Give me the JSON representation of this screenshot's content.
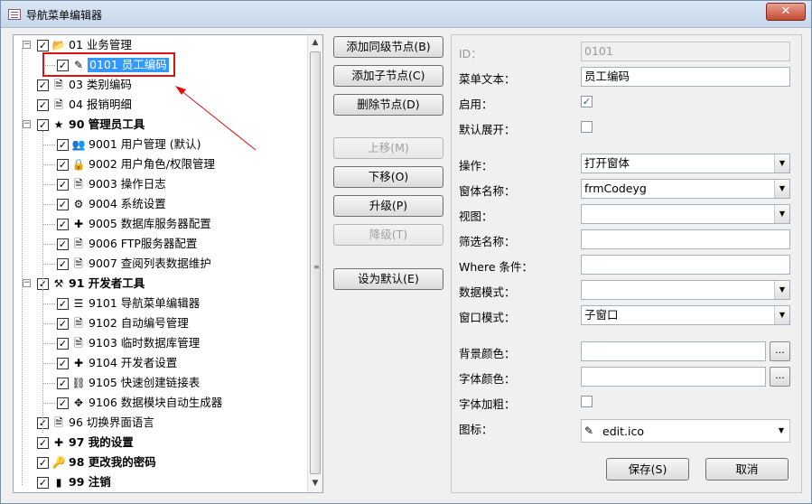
{
  "window": {
    "title": "导航菜单编辑器",
    "close_symbol": "✕"
  },
  "tree": {
    "nodes": [
      {
        "label": "01 业务管理",
        "icon": "folder-open-icon",
        "glyph": "📂",
        "bold": false,
        "checked": true,
        "level": 0,
        "expander": "−"
      },
      {
        "label": "0101 员工编码",
        "icon": "edit-icon",
        "glyph": "✎",
        "bold": false,
        "checked": true,
        "level": 1,
        "selected": true
      },
      {
        "label": "03 类别编码",
        "icon": "document-icon",
        "glyph": "🗎",
        "bold": false,
        "checked": true,
        "level": 0
      },
      {
        "label": "04 报销明细",
        "icon": "document-icon",
        "glyph": "🗎",
        "bold": false,
        "checked": true,
        "level": 0
      },
      {
        "label": "90 管理员工具",
        "icon": "star-icon",
        "glyph": "★",
        "bold": true,
        "checked": true,
        "level": 0,
        "expander": "−"
      },
      {
        "label": "9001 用户管理 (默认)",
        "icon": "users-icon",
        "glyph": "👥",
        "bold": false,
        "checked": true,
        "level": 1
      },
      {
        "label": "9002 用户角色/权限管理",
        "icon": "lock-icon",
        "glyph": "🔒",
        "bold": false,
        "checked": true,
        "level": 1
      },
      {
        "label": "9003 操作日志",
        "icon": "document-icon",
        "glyph": "🗎",
        "bold": false,
        "checked": true,
        "level": 1
      },
      {
        "label": "9004 系统设置",
        "icon": "settings-doc-icon",
        "glyph": "⚙",
        "bold": false,
        "checked": true,
        "level": 1
      },
      {
        "label": "9005 数据库服务器配置",
        "icon": "puzzle-icon",
        "glyph": "✚",
        "bold": false,
        "checked": true,
        "level": 1
      },
      {
        "label": "9006 FTP服务器配置",
        "icon": "document-icon",
        "glyph": "🗎",
        "bold": false,
        "checked": true,
        "level": 1
      },
      {
        "label": "9007 查阅列表数据维护",
        "icon": "document-icon",
        "glyph": "🗎",
        "bold": false,
        "checked": true,
        "level": 1
      },
      {
        "label": "91 开发者工具",
        "icon": "tools-icon",
        "glyph": "⚒",
        "bold": true,
        "checked": true,
        "level": 0,
        "expander": "−"
      },
      {
        "label": "9101 导航菜单编辑器",
        "icon": "menu-list-icon",
        "glyph": "☰",
        "bold": false,
        "checked": true,
        "level": 1
      },
      {
        "label": "9102 自动编号管理",
        "icon": "document-icon",
        "glyph": "🗎",
        "bold": false,
        "checked": true,
        "level": 1
      },
      {
        "label": "9103 临时数据库管理",
        "icon": "document-icon",
        "glyph": "🗎",
        "bold": false,
        "checked": true,
        "level": 1
      },
      {
        "label": "9104 开发者设置",
        "icon": "puzzle-icon",
        "glyph": "✚",
        "bold": false,
        "checked": true,
        "level": 1
      },
      {
        "label": "9105 快速创建链接表",
        "icon": "link-icon",
        "glyph": "⛓",
        "bold": false,
        "checked": true,
        "level": 1
      },
      {
        "label": "9106 数据模块自动生成器",
        "icon": "generator-icon",
        "glyph": "✥",
        "bold": false,
        "checked": true,
        "level": 1
      },
      {
        "label": "96 切换界面语言",
        "icon": "document-icon",
        "glyph": "🗎",
        "bold": false,
        "checked": true,
        "level": 0
      },
      {
        "label": "97 我的设置",
        "icon": "puzzle-icon",
        "glyph": "✚",
        "bold": true,
        "checked": true,
        "level": 0
      },
      {
        "label": "98 更改我的密码",
        "icon": "key-icon",
        "glyph": "🔑",
        "bold": true,
        "checked": true,
        "level": 0
      },
      {
        "label": "99 注销",
        "icon": "exit-icon",
        "glyph": "▮",
        "bold": true,
        "checked": true,
        "level": 0
      }
    ]
  },
  "actions": {
    "add_sibling": "添加同级节点(B)",
    "add_child": "添加子节点(C)",
    "delete_node": "删除节点(D)",
    "move_up": "上移(M)",
    "move_down": "下移(O)",
    "upgrade": "升级(P)",
    "downgrade": "降级(T)",
    "set_default": "设为默认(E)"
  },
  "form": {
    "id_label": "ID：",
    "id_value": "0101",
    "menu_text_label": "菜单文本：",
    "menu_text_value": "员工编码",
    "enabled_label": "启用：",
    "enabled": true,
    "expand_label": "默认展开：",
    "expand": false,
    "operation_label": "操作：",
    "operation_value": "打开窗体",
    "form_name_label": "窗体名称：",
    "form_name_value": "frmCodeyg",
    "view_label": "视图：",
    "view_value": "",
    "filter_label": "筛选名称：",
    "filter_value": "",
    "where_label": "Where 条件：",
    "where_value": "",
    "data_mode_label": "数据模式：",
    "data_mode_value": "",
    "window_mode_label": "窗口模式：",
    "window_mode_value": "子窗口",
    "bg_color_label": "背景颜色：",
    "bg_color_value": "",
    "font_color_label": "字体颜色：",
    "font_color_value": "",
    "bold_label": "字体加粗：",
    "bold": false,
    "icon_label": "图标：",
    "icon_value": "edit.ico",
    "browse_label": "...",
    "save": "保存(S)",
    "cancel": "取消"
  },
  "colors": {
    "selection": "#3399ff",
    "highlight_box": "#e01010",
    "annotation_arrow": "#e01010"
  }
}
